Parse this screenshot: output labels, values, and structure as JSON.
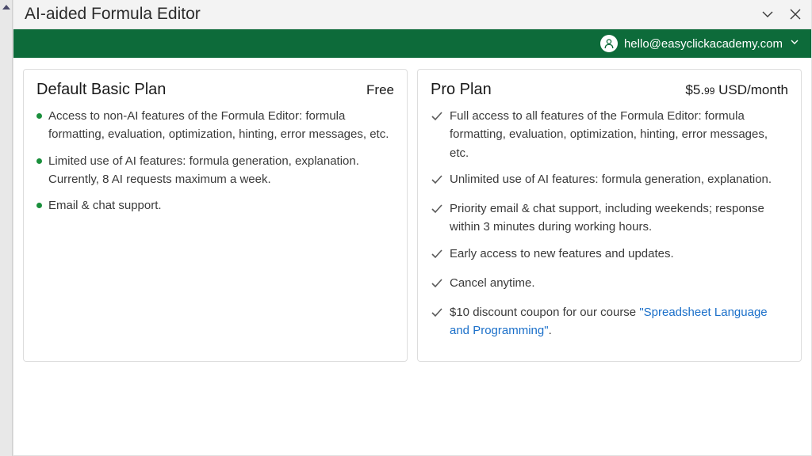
{
  "window": {
    "title": "AI-aided Formula Editor"
  },
  "user": {
    "email": "hello@easyclickacademy.com"
  },
  "plans": {
    "basic": {
      "name": "Default Basic Plan",
      "price": "Free",
      "features": [
        "Access to non-AI features of the Formula Editor: formula formatting, evaluation, optimization, hinting, error messages, etc.",
        "Limited use of AI features: formula generation, explanation. Currently, 8 AI requests maximum a week.",
        "Email & chat support."
      ]
    },
    "pro": {
      "name": "Pro Plan",
      "price_main": "$5.",
      "price_cents": "99",
      "price_suffix": " USD/month",
      "features": [
        "Full access to all features of the Formula Editor: formula formatting, evaluation, optimization, hinting, error messages, etc.",
        "Unlimited use of AI features: formula generation, explanation.",
        "Priority email & chat support, including weekends; response within 3 minutes during working hours.",
        "Early access to new features and updates.",
        "Cancel anytime."
      ],
      "coupon_prefix": "$10 discount coupon for our course ",
      "coupon_link": "\"Spreadsheet Language and Programming\"",
      "coupon_suffix": "."
    }
  }
}
